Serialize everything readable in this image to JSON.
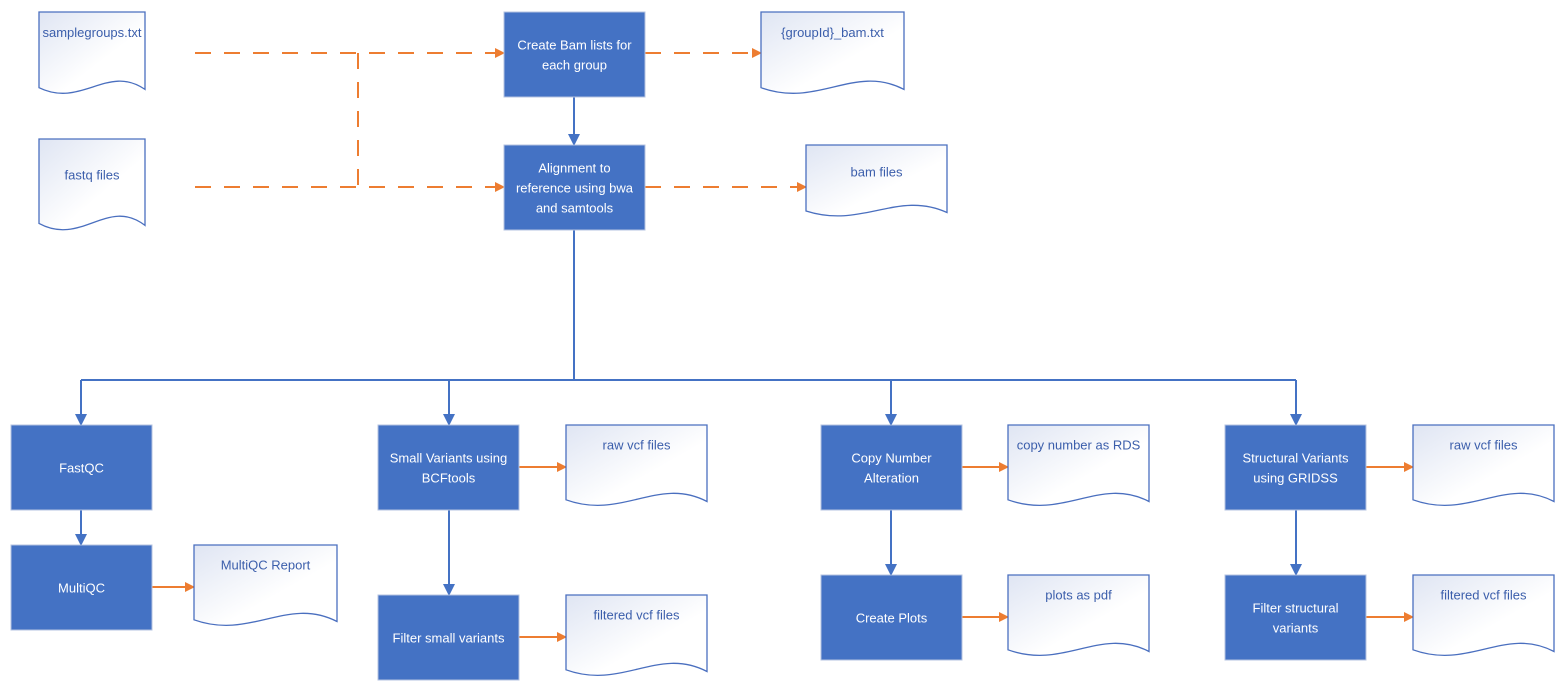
{
  "colors": {
    "process_fill": "#4472c4",
    "process_stroke": "#b4c3e0",
    "doc_stroke": "#4a6fbf",
    "doc_text": "#3b5eab",
    "data_flow": "#ed7d31",
    "process_flow": "#4472c4"
  },
  "processes": {
    "create_bam": [
      "Create Bam lists for",
      "each group"
    ],
    "align": [
      "Alignment to",
      "reference using bwa",
      "and samtools"
    ],
    "fastqc": [
      "FastQC"
    ],
    "multiqc": [
      "MultiQC"
    ],
    "small_var": [
      "Small Variants using",
      "BCFtools"
    ],
    "filter_small": [
      "Filter small variants"
    ],
    "cna": [
      "Copy Number",
      "Alteration"
    ],
    "plots": [
      "Create Plots"
    ],
    "sv": [
      "Structural Variants",
      "using GRIDSS"
    ],
    "filter_sv": [
      "Filter structural",
      "variants"
    ]
  },
  "documents": {
    "samplegroups": "samplegroups.txt",
    "fastq": "fastq files",
    "groupid_bam": "{groupId}_bam.txt",
    "bam": "bam files",
    "multiqc_report": "MultiQC Report",
    "raw_vcf_small": "raw vcf files",
    "filtered_vcf_small": "filtered vcf files",
    "copy_number": "copy number as RDS",
    "plots_pdf": "plots as pdf",
    "raw_vcf_sv": "raw vcf files",
    "filtered_vcf_sv": "filtered vcf files"
  }
}
